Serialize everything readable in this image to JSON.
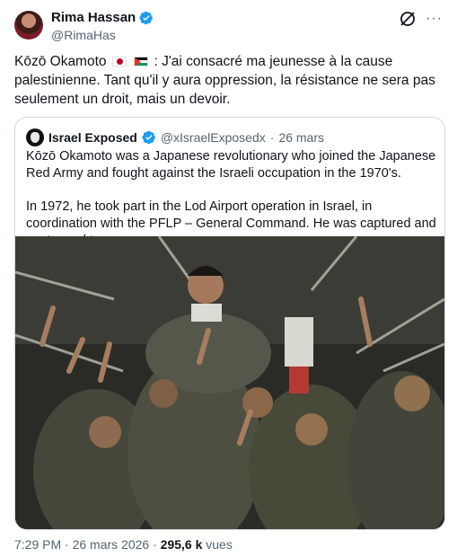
{
  "author": {
    "name": "Rima Hassan",
    "handle": "@RimaHas"
  },
  "tweet": {
    "name_prefix": "Kōzō Okamoto",
    "text_after_flags": ": J'ai consacré ma jeunesse à la cause palestinienne. Tant qu'il y aura oppression, la résistance ne sera pas seulement un droit, mais un devoir.",
    "flags": [
      "japan-flag-icon",
      "palestine-flag-icon"
    ]
  },
  "quoted": {
    "name": "Israel Exposed",
    "handle": "@xIsraelExposedx",
    "separator": "·",
    "date": "26 mars",
    "paragraph_1": "Kōzō Okamoto was a Japanese revolutionary who joined the Japanese Red Army and fought against the Israeli occupation in the 1970's.",
    "paragraph_2": "In 1972, he took part in the Lod Airport operation in Israel, in coordination with the PFLP – General Command. He was captured and sentenced to"
  },
  "footer": {
    "time": "7:29 PM",
    "separator": "·",
    "date": "26 mars 2026",
    "separator2": "·",
    "views_count": "295,6 k",
    "views_label": "vues"
  },
  "colors": {
    "verified": "#1d9bf0",
    "secondary_text": "#536471",
    "border": "#cfd9de"
  }
}
